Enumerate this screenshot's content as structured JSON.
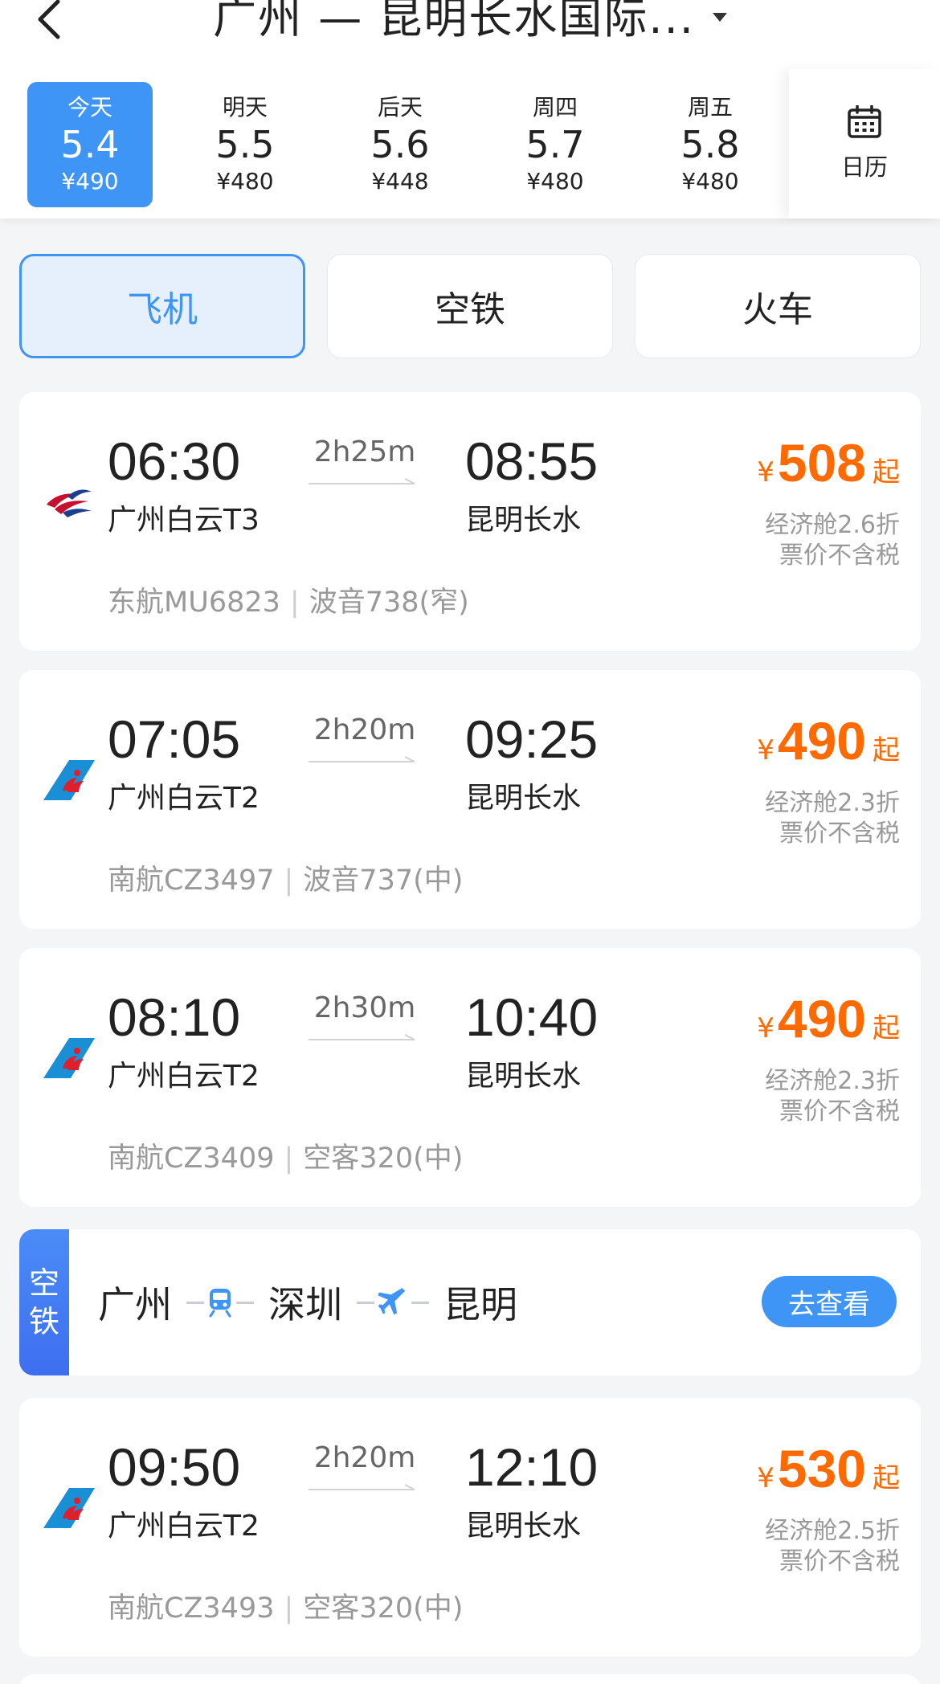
{
  "header": {
    "title": "广州 — 昆明长水国际...",
    "back_icon": "chevron-left-icon",
    "dropdown_icon": "caret-down-icon"
  },
  "dates": [
    {
      "label": "今天",
      "date": "5.4",
      "price": "¥490",
      "active": true
    },
    {
      "label": "明天",
      "date": "5.5",
      "price": "¥480",
      "active": false
    },
    {
      "label": "后天",
      "date": "5.6",
      "price": "¥448",
      "active": false
    },
    {
      "label": "周四",
      "date": "5.7",
      "price": "¥480",
      "active": false
    },
    {
      "label": "周五",
      "date": "5.8",
      "price": "¥480",
      "active": false
    }
  ],
  "calendar": {
    "label": "日历",
    "icon": "calendar-icon"
  },
  "tabs": [
    {
      "label": "飞机",
      "active": true
    },
    {
      "label": "空铁",
      "active": false
    },
    {
      "label": "火车",
      "active": false
    }
  ],
  "flights": [
    {
      "airline_logo": "china-eastern-logo",
      "dep_time": "06:30",
      "arr_time": "08:55",
      "duration": "2h25m",
      "dep_airport": "广州白云T3",
      "arr_airport": "昆明长水",
      "flight_no": "东航MU6823",
      "aircraft": "波音738(窄)",
      "currency": "¥",
      "price": "508",
      "price_suffix": "起",
      "discount": "经济舱2.6折",
      "tax_note": "票价不含税"
    },
    {
      "airline_logo": "china-southern-logo",
      "dep_time": "07:05",
      "arr_time": "09:25",
      "duration": "2h20m",
      "dep_airport": "广州白云T2",
      "arr_airport": "昆明长水",
      "flight_no": "南航CZ3497",
      "aircraft": "波音737(中)",
      "currency": "¥",
      "price": "490",
      "price_suffix": "起",
      "discount": "经济舱2.3折",
      "tax_note": "票价不含税"
    },
    {
      "airline_logo": "china-southern-logo",
      "dep_time": "08:10",
      "arr_time": "10:40",
      "duration": "2h30m",
      "dep_airport": "广州白云T2",
      "arr_airport": "昆明长水",
      "flight_no": "南航CZ3409",
      "aircraft": "空客320(中)",
      "currency": "¥",
      "price": "490",
      "price_suffix": "起",
      "discount": "经济舱2.3折",
      "tax_note": "票价不含税"
    },
    {
      "airline_logo": "china-southern-logo",
      "dep_time": "09:50",
      "arr_time": "12:10",
      "duration": "2h20m",
      "dep_airport": "广州白云T2",
      "arr_airport": "昆明长水",
      "flight_no": "南航CZ3493",
      "aircraft": "空客320(中)",
      "currency": "¥",
      "price": "530",
      "price_suffix": "起",
      "discount": "经济舱2.5折",
      "tax_note": "票价不含税"
    }
  ],
  "air_rail": {
    "tag_line1": "空",
    "tag_line2": "铁",
    "from": "广州",
    "via": "深圳",
    "to": "昆明",
    "leg1_icon": "train-icon",
    "leg2_icon": "plane-icon",
    "button": "去查看"
  },
  "colors": {
    "accent": "#3e95f5",
    "price": "#ff6a00",
    "muted": "#999999"
  }
}
